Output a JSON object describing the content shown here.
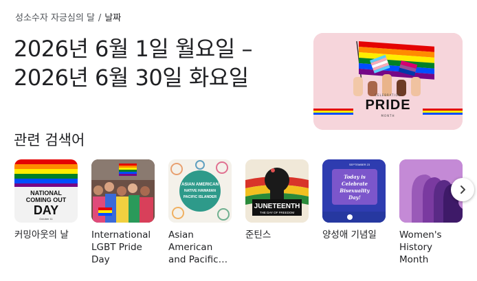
{
  "breadcrumb": {
    "parent": "성소수자 자긍심의 달",
    "separator": "/",
    "current": "날짜"
  },
  "main": {
    "date_line1": "2026년 6월 1일 월요일 –",
    "date_line2": "2026년 6월 30일 화요일"
  },
  "hero": {
    "celebration": "CELEBRATION",
    "title": "PRIDE",
    "month": "MONTH"
  },
  "related": {
    "title": "관련 검색어",
    "cards": [
      {
        "label": "커밍아웃의 날",
        "thumb_text": [
          "NATIONAL",
          "COMING OUT",
          "DAY",
          "October 11"
        ]
      },
      {
        "label": "International LGBT Pride Day"
      },
      {
        "label": "Asian American and Pacific…",
        "thumb_text": [
          "ASIAN AMERICAN",
          "NATIVE HAWAIIAN",
          "PACIFIC ISLANDER"
        ]
      },
      {
        "label": "준틴스",
        "thumb_text": [
          "JUNETEENTH",
          "THE DAY OF FREEDOM"
        ]
      },
      {
        "label": "양성애 기념일",
        "thumb_text": [
          "SEPTEMBER 23",
          "Today is",
          "Celebrate",
          "Bisexuality",
          "Day!"
        ]
      },
      {
        "label": "Women's History Month"
      }
    ]
  },
  "icons": {
    "next": "chevron-right-icon"
  },
  "colors": {
    "pride": [
      "#e40303",
      "#ff8c00",
      "#ffed00",
      "#008026",
      "#004dff",
      "#750787"
    ],
    "hero_bg": "#f6d5db"
  }
}
